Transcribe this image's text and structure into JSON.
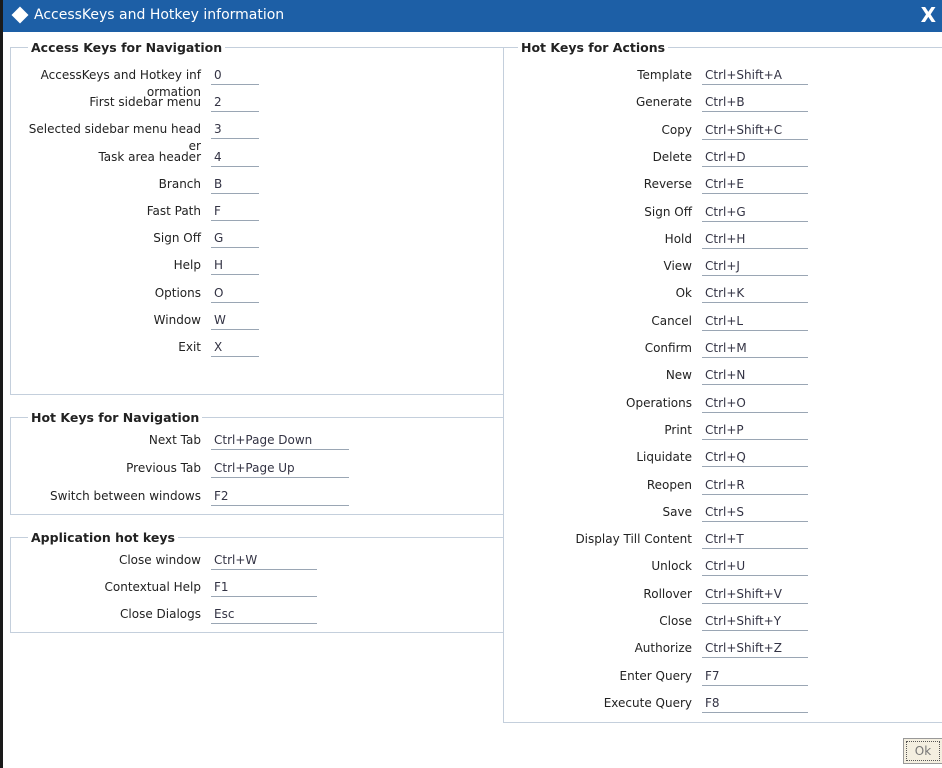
{
  "window": {
    "title": "AccessKeys and Hotkey information",
    "close_label": "X"
  },
  "access_keys": {
    "legend": "Access Keys for Navigation",
    "rows": [
      {
        "label": "AccessKeys and Hotkey inf\normation",
        "key": "0"
      },
      {
        "label": "First sidebar menu",
        "key": "2"
      },
      {
        "label": "Selected sidebar menu head\ner",
        "key": "3"
      },
      {
        "label": "Task area header",
        "key": "4"
      },
      {
        "label": "Branch",
        "key": "B"
      },
      {
        "label": "Fast Path",
        "key": "F"
      },
      {
        "label": "Sign Off",
        "key": "G"
      },
      {
        "label": "Help",
        "key": "H"
      },
      {
        "label": "Options",
        "key": "O"
      },
      {
        "label": "Window",
        "key": "W"
      },
      {
        "label": "Exit",
        "key": "X"
      }
    ]
  },
  "hot_keys_nav": {
    "legend": "Hot Keys for Navigation",
    "rows": [
      {
        "label": "Next Tab",
        "key": "Ctrl+Page Down"
      },
      {
        "label": "Previous Tab",
        "key": "Ctrl+Page Up"
      },
      {
        "label": "Switch between windows",
        "key": "F2"
      }
    ]
  },
  "app_hot_keys": {
    "legend": "Application hot keys",
    "rows": [
      {
        "label": "Close window",
        "key": "Ctrl+W"
      },
      {
        "label": "Contextual Help",
        "key": "F1"
      },
      {
        "label": "Close Dialogs",
        "key": "Esc"
      }
    ]
  },
  "hot_keys_actions": {
    "legend": "Hot Keys for Actions",
    "rows": [
      {
        "label": "Template",
        "key": "Ctrl+Shift+A"
      },
      {
        "label": "Generate",
        "key": "Ctrl+B"
      },
      {
        "label": "Copy",
        "key": "Ctrl+Shift+C"
      },
      {
        "label": "Delete",
        "key": "Ctrl+D"
      },
      {
        "label": "Reverse",
        "key": "Ctrl+E"
      },
      {
        "label": "Sign Off",
        "key": "Ctrl+G"
      },
      {
        "label": "Hold",
        "key": "Ctrl+H"
      },
      {
        "label": "View",
        "key": "Ctrl+J"
      },
      {
        "label": "Ok",
        "key": "Ctrl+K"
      },
      {
        "label": "Cancel",
        "key": "Ctrl+L"
      },
      {
        "label": "Confirm",
        "key": "Ctrl+M"
      },
      {
        "label": "New",
        "key": "Ctrl+N"
      },
      {
        "label": "Operations",
        "key": "Ctrl+O"
      },
      {
        "label": "Print",
        "key": "Ctrl+P"
      },
      {
        "label": "Liquidate",
        "key": "Ctrl+Q"
      },
      {
        "label": "Reopen",
        "key": "Ctrl+R"
      },
      {
        "label": "Save",
        "key": "Ctrl+S"
      },
      {
        "label": "Display Till Content",
        "key": "Ctrl+T"
      },
      {
        "label": "Unlock",
        "key": "Ctrl+U"
      },
      {
        "label": "Rollover",
        "key": "Ctrl+Shift+V"
      },
      {
        "label": "Close",
        "key": "Ctrl+Shift+Y"
      },
      {
        "label": "Authorize",
        "key": "Ctrl+Shift+Z"
      },
      {
        "label": "Enter Query",
        "key": "F7"
      },
      {
        "label": "Execute Query",
        "key": "F8"
      }
    ]
  },
  "footer": {
    "ok_label": "Ok"
  },
  "colors": {
    "titlebar": "#1d5fa6",
    "panel_border": "#c4cfdc",
    "field_underline": "#9aa6b4"
  }
}
